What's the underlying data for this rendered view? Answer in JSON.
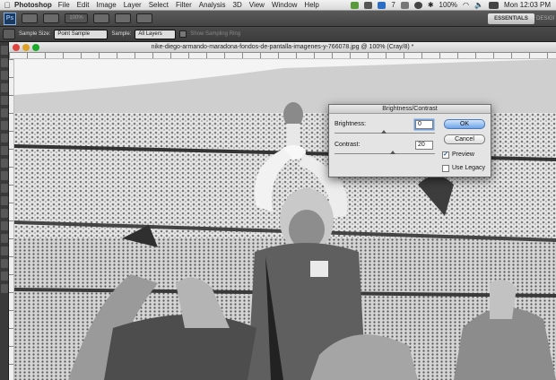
{
  "menubar": {
    "app_name": "Photoshop",
    "items": [
      "File",
      "Edit",
      "Image",
      "Layer",
      "Select",
      "Filter",
      "Analysis",
      "3D",
      "View",
      "Window",
      "Help"
    ],
    "status": {
      "number": "7",
      "battery": "100%",
      "clock": "Mon 12:03 PM"
    }
  },
  "appbar": {
    "logo": "Ps",
    "zoom": "100%",
    "essentials": "ESSENTIALS",
    "design": "DESIGN"
  },
  "options": {
    "sample_size_label": "Sample Size:",
    "sample_size_value": "Point Sample",
    "sample_label": "Sample:",
    "sample_value": "All Layers",
    "show_ring_label": "Show Sampling Ring"
  },
  "document": {
    "title": "nike-diego-armando-maradona-fondos-de-pantalla-imagenes-y-766078.jpg @ 100% (Cray/8) *"
  },
  "dialog": {
    "title": "Brightness/Contrast",
    "brightness_label": "Brightness:",
    "brightness_value": "0",
    "contrast_label": "Contrast:",
    "contrast_value": "20",
    "ok_label": "OK",
    "cancel_label": "Cancel",
    "preview_label": "Preview",
    "preview_checked": true,
    "legacy_label": "Use Legacy",
    "legacy_checked": false
  },
  "colors": {
    "dialog_bg": "#e4e4e4",
    "ok_button": "#6fa4e8",
    "toolbar": "#3a3a3a"
  }
}
